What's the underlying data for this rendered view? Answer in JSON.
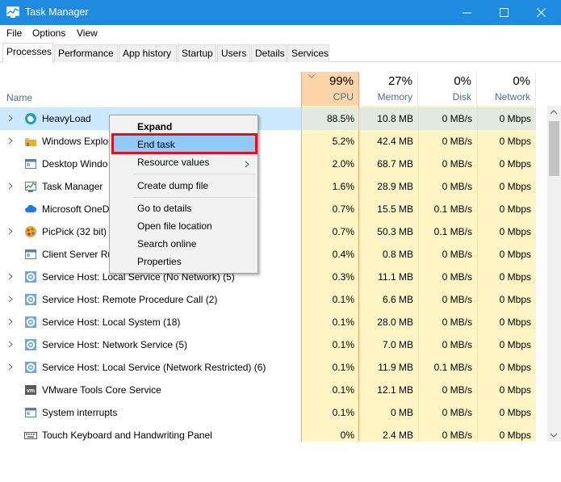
{
  "window": {
    "title": "Task Manager",
    "colors": {
      "titlebar": "#1e8ae0",
      "cpu_header": "#fbd4a8",
      "cpu_bg": "#fff4c4",
      "selected": "#cce8ff",
      "highlight_box": "#e0101e"
    }
  },
  "menu": [
    "File",
    "Options",
    "View"
  ],
  "tabs": [
    "Processes",
    "Performance",
    "App history",
    "Startup",
    "Users",
    "Details",
    "Services"
  ],
  "columns": {
    "name": "Name",
    "cpu": {
      "pct": "99%",
      "label": "CPU"
    },
    "memory": {
      "pct": "27%",
      "label": "Memory"
    },
    "disk": {
      "pct": "0%",
      "label": "Disk"
    },
    "network": {
      "pct": "0%",
      "label": "Network"
    }
  },
  "rows": [
    {
      "name": "HeavyLoad",
      "icon": "heavyload-icon",
      "expand": true,
      "cpu": "88.5%",
      "mem": "10.8 MB",
      "disk": "0 MB/s",
      "net": "0 Mbps"
    },
    {
      "name": "Windows Explor",
      "icon": "folder-icon",
      "expand": true,
      "cpu": "5.2%",
      "mem": "42.4 MB",
      "disk": "0 MB/s",
      "net": "0 Mbps"
    },
    {
      "name": "Desktop Windo",
      "icon": "window-icon",
      "expand": false,
      "cpu": "2.0%",
      "mem": "68.7 MB",
      "disk": "0 MB/s",
      "net": "0 Mbps"
    },
    {
      "name": "Task Manager",
      "icon": "task-manager-icon",
      "expand": true,
      "cpu": "1.6%",
      "mem": "28.9 MB",
      "disk": "0 MB/s",
      "net": "0 Mbps"
    },
    {
      "name": "Microsoft OneD",
      "icon": "cloud-icon",
      "expand": false,
      "cpu": "0.7%",
      "mem": "15.5 MB",
      "disk": "0.1 MB/s",
      "net": "0 Mbps"
    },
    {
      "name": "PicPick (32 bit)",
      "icon": "picpick-icon",
      "expand": true,
      "cpu": "0.7%",
      "mem": "50.3 MB",
      "disk": "0.1 MB/s",
      "net": "0 Mbps"
    },
    {
      "name": "Client Server Ru",
      "icon": "window-icon",
      "expand": false,
      "cpu": "0.4%",
      "mem": "0.8 MB",
      "disk": "0 MB/s",
      "net": "0 Mbps"
    },
    {
      "name": "Service Host: Local Service (No Network) (5)",
      "icon": "gear-icon",
      "expand": true,
      "cpu": "0.3%",
      "mem": "11.1 MB",
      "disk": "0 MB/s",
      "net": "0 Mbps"
    },
    {
      "name": "Service Host: Remote Procedure Call (2)",
      "icon": "gear-icon",
      "expand": true,
      "cpu": "0.1%",
      "mem": "6.6 MB",
      "disk": "0 MB/s",
      "net": "0 Mbps"
    },
    {
      "name": "Service Host: Local System (18)",
      "icon": "gear-icon",
      "expand": true,
      "cpu": "0.1%",
      "mem": "28.0 MB",
      "disk": "0 MB/s",
      "net": "0 Mbps"
    },
    {
      "name": "Service Host: Network Service (5)",
      "icon": "gear-icon",
      "expand": true,
      "cpu": "0.1%",
      "mem": "7.0 MB",
      "disk": "0 MB/s",
      "net": "0 Mbps"
    },
    {
      "name": "Service Host: Local Service (Network Restricted) (6)",
      "icon": "gear-icon",
      "expand": true,
      "cpu": "0.1%",
      "mem": "11.9 MB",
      "disk": "0.1 MB/s",
      "net": "0 Mbps"
    },
    {
      "name": "VMware Tools Core Service",
      "icon": "vmware-icon",
      "expand": false,
      "cpu": "0.1%",
      "mem": "12.1 MB",
      "disk": "0 MB/s",
      "net": "0 Mbps"
    },
    {
      "name": "System interrupts",
      "icon": "window-icon",
      "expand": false,
      "cpu": "0.1%",
      "mem": "0 MB",
      "disk": "0 MB/s",
      "net": "0 Mbps"
    },
    {
      "name": "Touch Keyboard and Handwriting Panel",
      "icon": "keyboard-icon",
      "expand": false,
      "cpu": "0%",
      "mem": "2.4 MB",
      "disk": "0 MB/s",
      "net": "0 Mbps"
    }
  ],
  "context_menu": {
    "items": [
      "Expand",
      "End task",
      "Resource values",
      "Create dump file",
      "Go to details",
      "Open file location",
      "Search online",
      "Properties"
    ]
  }
}
